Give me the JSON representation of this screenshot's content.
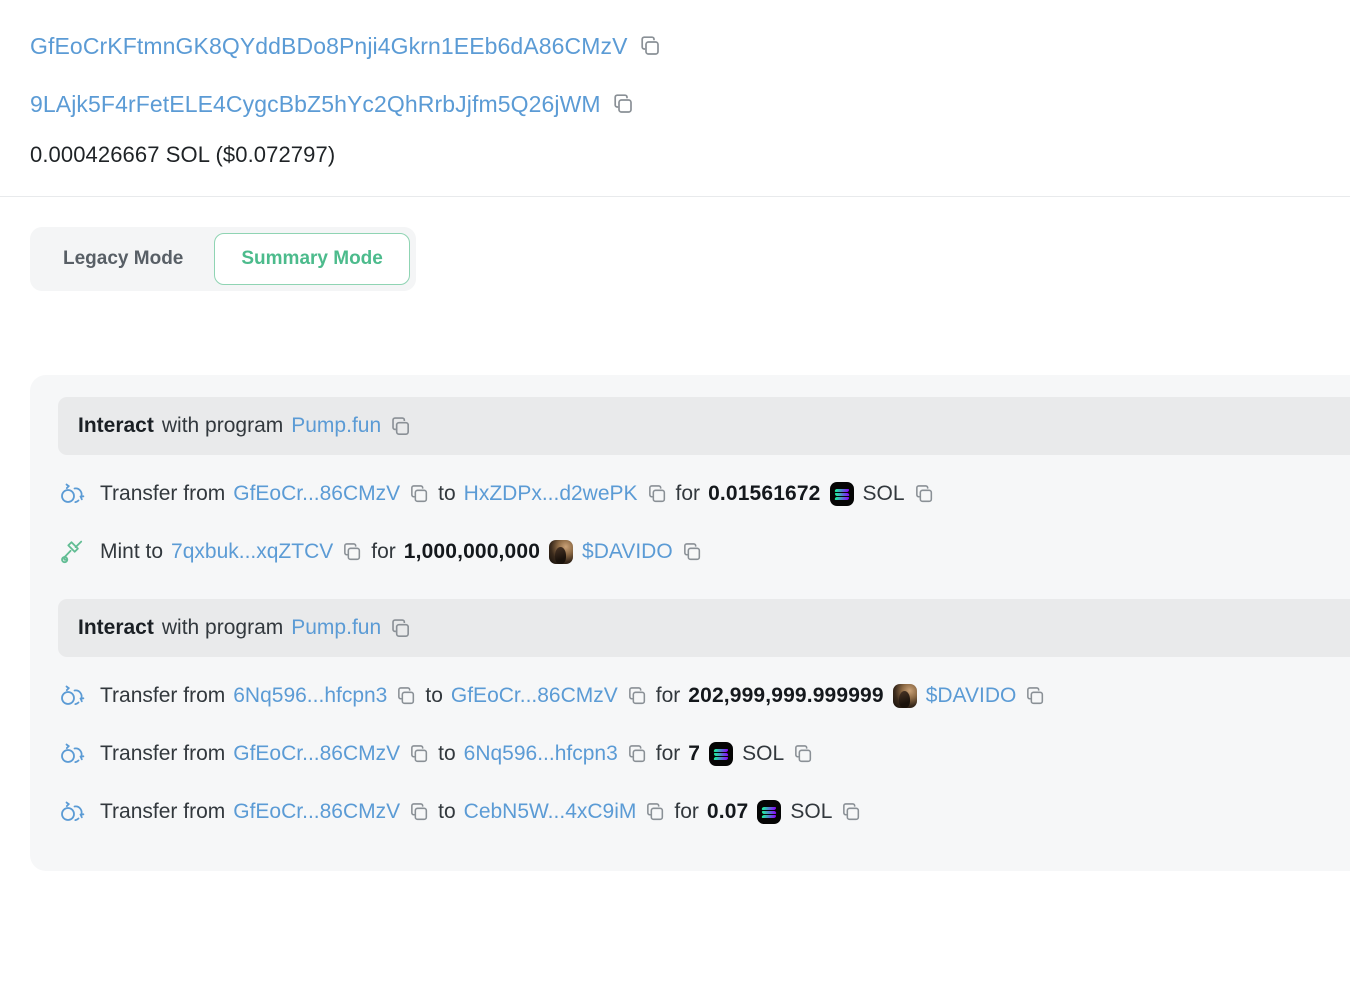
{
  "header": {
    "addresses": [
      {
        "value": "GfEoCrKFtmnGK8QYddBDo8Pnji4Gkrn1EEb6dA86CMzV",
        "copy_label": "Copy address"
      },
      {
        "value": "9LAjk5F4rFetELE4CygcBbZ5hYc2QhRrbJjfm5Q26jWM",
        "copy_label": "Copy address"
      }
    ],
    "fee_amount": "0.000426667 SOL ($0.072797)"
  },
  "mode_toggle": {
    "legacy_label": "Legacy Mode",
    "summary_label": "Summary Mode",
    "active": "Summary Mode",
    "active_color": "#4cbb8c",
    "inactive_color": "#585f66"
  },
  "summary": {
    "groups": [
      {
        "program_prefix": "Interact",
        "program_middle": "with program",
        "program_name": "Pump.fun",
        "instructions": [
          {
            "icon": "transfer-icon",
            "label_verb": "Transfer from",
            "from": "GfEoCr...86CMzV",
            "to_label": "to",
            "to": "HxZDPx...d2wePK",
            "for_label": "for",
            "amount": "0.01561672",
            "token_icon": "sol-token-icon",
            "token": "SOL"
          },
          {
            "icon": "mint-icon",
            "label_verb": "Mint to",
            "from": "",
            "to_label": "",
            "to": "7qxbuk...xqZTCV",
            "for_label": "for",
            "amount": "1,000,000,000",
            "token_icon": "davido-token-icon",
            "token": "$DAVIDO"
          }
        ]
      },
      {
        "program_prefix": "Interact",
        "program_middle": "with program",
        "program_name": "Pump.fun",
        "instructions": [
          {
            "icon": "transfer-icon",
            "label_verb": "Transfer from",
            "from": "6Nq596...hfcpn3",
            "to_label": "to",
            "to": "GfEoCr...86CMzV",
            "for_label": "for",
            "amount": "202,999,999.999999",
            "token_icon": "davido-token-icon",
            "token": "$DAVIDO"
          },
          {
            "icon": "transfer-icon",
            "label_verb": "Transfer from",
            "from": "GfEoCr...86CMzV",
            "to_label": "to",
            "to": "6Nq596...hfcpn3",
            "for_label": "for",
            "amount": "7",
            "token_icon": "sol-token-icon",
            "token": "SOL"
          },
          {
            "icon": "transfer-icon",
            "label_verb": "Transfer from",
            "from": "GfEoCr...86CMzV",
            "to_label": "to",
            "to": "CebN5W...4xC9iM",
            "for_label": "for",
            "amount": "0.07",
            "token_icon": "sol-token-icon",
            "token": "SOL"
          }
        ]
      }
    ]
  },
  "colors": {
    "link": "#5b9bd5",
    "accent_green": "#4cbb8c",
    "card_bg": "#f6f7f8",
    "program_bar_bg": "#e9eaeb",
    "text": "#32383d"
  }
}
